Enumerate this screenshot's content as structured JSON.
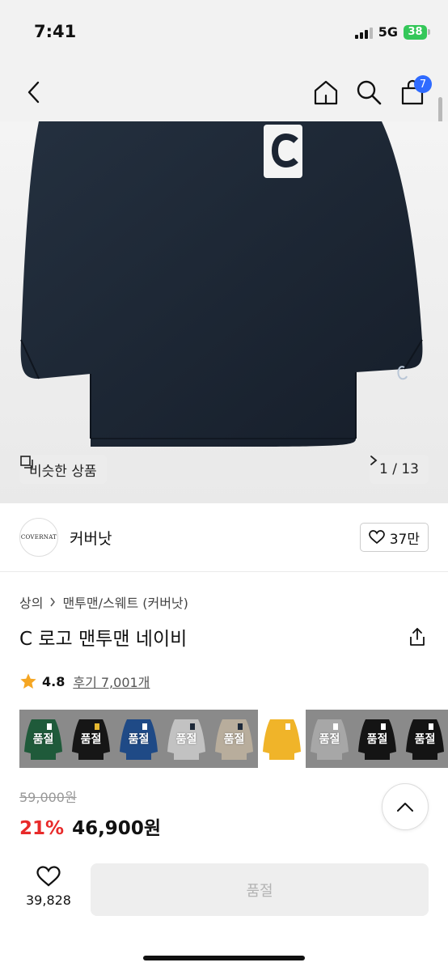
{
  "status": {
    "time": "7:41",
    "network": "5G",
    "battery": "38"
  },
  "nav": {
    "cart_count": "7"
  },
  "hero": {
    "similar_label": "비슷한 상품",
    "page_indicator": "1 / 13"
  },
  "brand": {
    "logo_text": "COVERNAT",
    "name": "커버낫",
    "likes": "37만"
  },
  "product": {
    "breadcrumb": [
      "상의",
      "맨투맨/스웨트 (커버낫)"
    ],
    "title": "C 로고 맨투맨 네이비",
    "rating": "4.8",
    "reviews": "후기 7,001개"
  },
  "swatches": [
    {
      "color": "#1f5a3a",
      "logo": "#ffffff",
      "label": "품절"
    },
    {
      "color": "#161616",
      "logo": "#e6b830",
      "label": "품절"
    },
    {
      "color": "#1f4a86",
      "logo": "#ffffff",
      "label": "품절"
    },
    {
      "color": "#c2c2c2",
      "logo": "#1e2a3a",
      "label": "품절"
    },
    {
      "color": "#b8ad9c",
      "logo": "#1e2a3a",
      "label": "품절"
    },
    {
      "color": "#f0b429",
      "logo": "#ffffff",
      "label": ""
    },
    {
      "color": "#a7a7a7",
      "logo": "#ffffff",
      "label": "품절"
    },
    {
      "color": "#141414",
      "logo": "#ffffff",
      "label": "품절"
    },
    {
      "color": "#141414",
      "logo": "#ffffff",
      "label": "품절"
    }
  ],
  "price": {
    "original": "59,000원",
    "discount": "21%",
    "sale": "46,900원"
  },
  "bottom": {
    "wishlist_count": "39,828",
    "buy_label": "품절"
  },
  "colors": {
    "accent": "#2f6bff",
    "discount": "#e82a2a",
    "sweatshirt": "#1c2533",
    "star": "#f5a623"
  }
}
